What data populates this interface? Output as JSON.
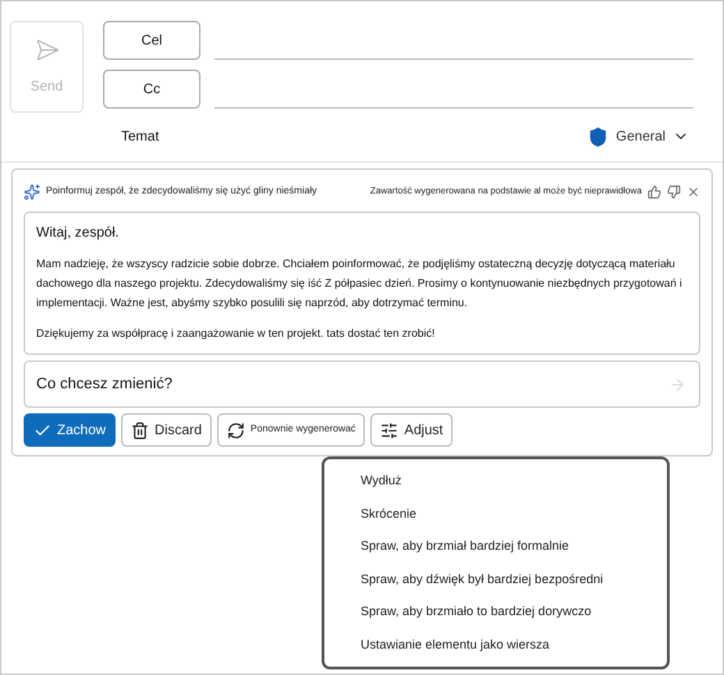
{
  "send_button": {
    "label": "Send",
    "disabled": true
  },
  "recipients": [
    {
      "label": "Cel"
    },
    {
      "label": "Cc"
    }
  ],
  "subject": {
    "label": "Temat"
  },
  "sensitivity": {
    "label": "General"
  },
  "draft": {
    "prompt": "Poinformuj zespół, że zdecydowaliśmy się użyć gliny nieśmiały",
    "disclaimer": "Zawartość wygenerowana na podstawie al może być nieprawidłowa",
    "paragraphs": [
      "Witaj, zespół.",
      "Mam nadzieję, że wszyscy radzicie sobie dobrze. Chciałem poinformować, że podjęliśmy ostateczną decyzję dotyczącą materiału dachowego dla naszego projektu. Zdecydowaliśmy się iść Z półpasiec dzień. Prosimy o kontynuowanie niezbędnych przygotowań i implementacji. Ważne jest, abyśmy szybko posulili się naprzód, aby dotrzymać terminu.",
      "Dziękujemy za współpracę i zaangażowanie w ten projekt. tats dostać ten zrobić!"
    ],
    "change_field": {
      "placeholder": "Co chcesz zmienić?"
    }
  },
  "actions": [
    {
      "kind": "keep",
      "label": "Zachow"
    },
    {
      "kind": "discard",
      "label": "Discard"
    },
    {
      "kind": "regenerate",
      "label": "Ponownie wygenerować"
    },
    {
      "kind": "adjust",
      "label": "Adjust"
    }
  ],
  "adjust_menu": [
    "Wydłuż",
    "Skrócenie",
    "Spraw, aby brzmiał bardziej formalnie",
    "Spraw, aby dźwięk był bardziej bezpośredni",
    "Spraw, aby brzmiało to bardziej dorywczo",
    "Ustawianie elementu jako wiersza"
  ]
}
